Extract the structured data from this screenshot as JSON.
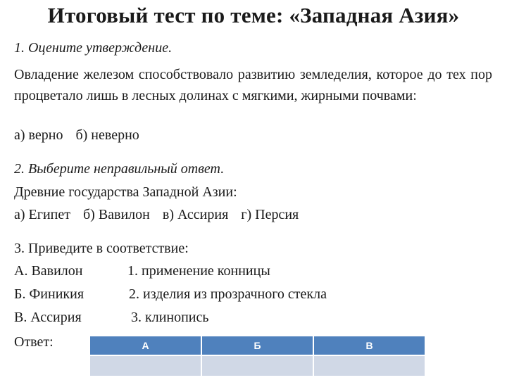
{
  "title": "Итоговый тест по теме: «Западная Азия»",
  "q1": {
    "heading": "1. Оцените утверждение.",
    "statement": "Овладение железом способствовало развитию земледелия, которое до тех пор процветало лишь в лесных долинах с мягкими, жирными почвами:",
    "options": [
      "а) верно",
      "б) неверно"
    ]
  },
  "q2": {
    "heading": "2. Выберите неправильный ответ.",
    "prompt": "Древние государства Западной Азии:",
    "options": [
      "а) Египет",
      "б) Вавилон",
      "в) Ассирия",
      "г) Персия"
    ]
  },
  "q3": {
    "heading": "3. Приведите в соответствие:",
    "left": [
      "А. Вавилон",
      "Б. Финикия",
      "В. Ассирия"
    ],
    "right": [
      "1. применение конницы",
      "2. изделия из прозрачного стекла",
      "3. клинопись"
    ],
    "answer_label": "Ответ:",
    "table_headers": [
      "А",
      "Б",
      "В"
    ],
    "table_values": [
      "",
      "",
      ""
    ]
  },
  "colors": {
    "table_header": "#4f81bd",
    "table_cell": "#d0d8e6"
  }
}
